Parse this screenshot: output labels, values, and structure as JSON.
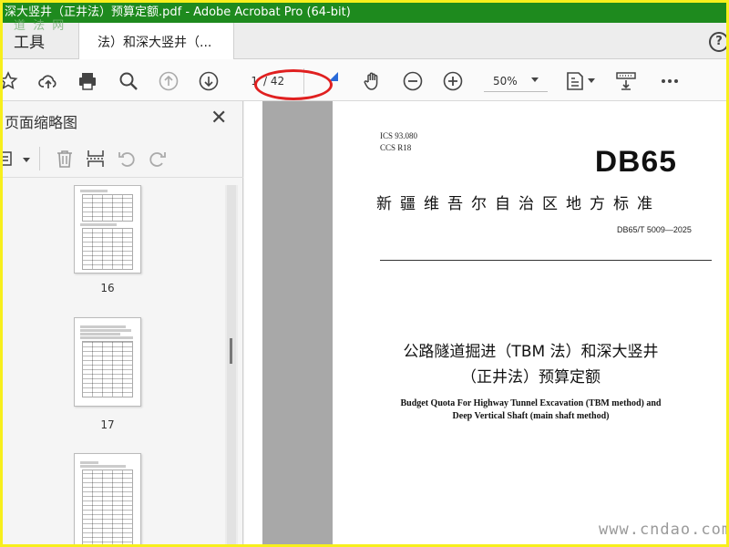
{
  "window": {
    "title": "深大竖井（正井法）预算定额.pdf - Adobe Acrobat Pro (64-bit)",
    "watermark_top": "道 法 网"
  },
  "tabs": {
    "tools_label": "工具",
    "doc_label": "法）和深大竖井（...",
    "help_symbol": "?"
  },
  "toolbar": {
    "current_page": "1",
    "total_pages": "/ 42",
    "zoom": "50%"
  },
  "thumbnail_panel": {
    "title": "页面缩略图",
    "close_symbol": "✕",
    "pages": [
      {
        "label": "16"
      },
      {
        "label": "17"
      },
      {
        "label": ""
      }
    ]
  },
  "document": {
    "ics_line": "ICS  93.080",
    "ccs_line": "CCS  R18",
    "std_logo": "DB65",
    "region": "新疆维吾尔自治区地方标准",
    "std_number": "DB65/T 5009—2025",
    "title_cn_line1": "公路隧道掘进（TBM 法）和深大竖井",
    "title_cn_line2": "（正井法）预算定额",
    "title_en_line1": "Budget Quota For Highway Tunnel Excavation (TBM method) and",
    "title_en_line2": "Deep Vertical Shaft (main shaft method)"
  },
  "watermark_bottom": "www.cndao.com",
  "colors": {
    "titlebar": "#1e8a1e",
    "frame": "#f7ef1c",
    "annotation": "#e02020",
    "gutter": "#a8a8a8"
  }
}
